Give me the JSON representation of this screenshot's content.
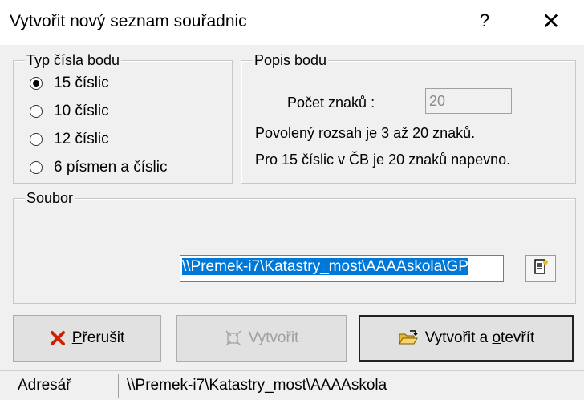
{
  "window": {
    "title": "Vytvořit nový seznam souřadnic",
    "help_glyph": "?",
    "close_glyph": "✕"
  },
  "point_type": {
    "legend": "Typ čísla bodu",
    "options": [
      {
        "label": "15 číslic",
        "selected": true
      },
      {
        "label": "10 číslic",
        "selected": false
      },
      {
        "label": "12 číslic",
        "selected": false
      },
      {
        "label": "6 písmen a číslic",
        "selected": false
      }
    ]
  },
  "point_desc": {
    "legend": "Popis bodu",
    "count_label": "Počet znaků :",
    "count_value": "20",
    "info_line1": "Povolený rozsah je 3 až 20 znaků.",
    "info_line2": "Pro 15 číslic v ČB je 20 znaků  napevno."
  },
  "file": {
    "legend": "Soubor",
    "path": "\\\\Premek-i7\\Katastry_most\\AAAAskola\\GP",
    "browse_icon": "document-icon"
  },
  "buttons": {
    "cancel_pre": "",
    "cancel_acc": "P",
    "cancel_post": "řerušit",
    "create_label": "Vytvořit",
    "create_open_pre": "Vytvořit a ",
    "create_open_acc": "o",
    "create_open_post": "tevřít"
  },
  "status": {
    "label": "Adresář",
    "path": "\\\\Premek-i7\\Katastry_most\\AAAAskola"
  },
  "colors": {
    "selection": "#0078d7",
    "cancel_icon": "#d02000",
    "folder_icon": "#e8b830"
  }
}
